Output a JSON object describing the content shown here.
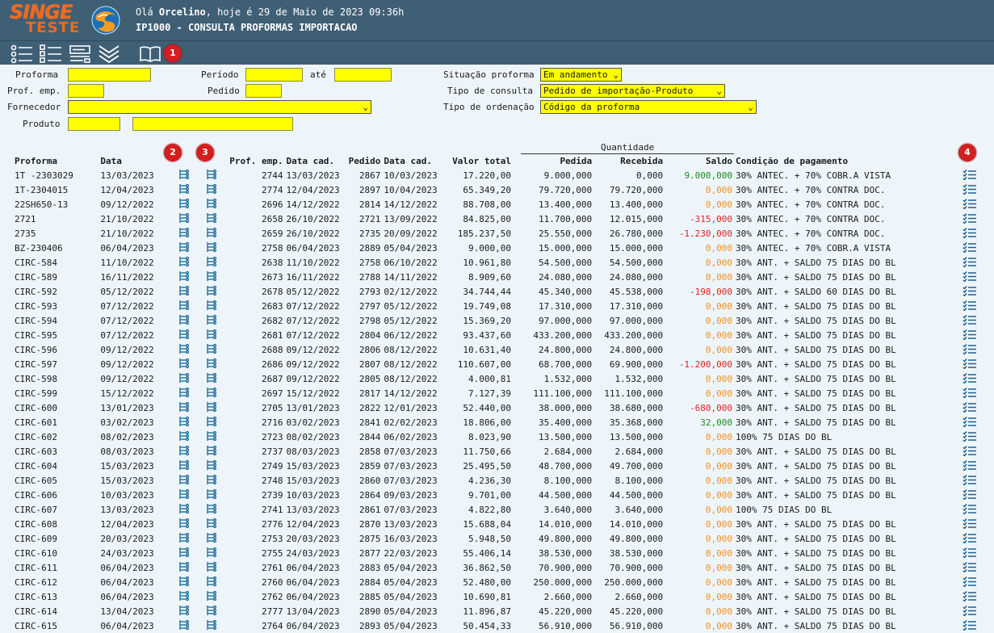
{
  "app": {
    "logo_top": "SINGE",
    "logo_bottom": "TESTE"
  },
  "header": {
    "greeting_pre": "Olá ",
    "user": "Orcelino",
    "greeting_post": ", hoje é 29 de Maio de 2023 09:36h",
    "program": "IP1000 - CONSULTA PROFORMAS IMPORTACAO"
  },
  "toolbar": {
    "badge": "1"
  },
  "form": {
    "proforma_label": "Proforma",
    "periodo_label": "Período",
    "ate_label": "até",
    "prof_emp_label": "Prof. emp.",
    "pedido_label": "Pedido",
    "fornecedor_label": "Fornecedor",
    "produto_label": "Produto",
    "situacao_label": "Situação proforma",
    "situacao_value": "Em andamento",
    "tipo_consulta_label": "Tipo de consulta",
    "tipo_consulta_value": "Pedido de importação-Produto",
    "tipo_ordenacao_label": "Tipo de ordenação",
    "tipo_ordenacao_value": "Código da proforma"
  },
  "badges": {
    "b2": "2",
    "b3": "3",
    "b4": "4"
  },
  "table": {
    "group_header": "Quantidade",
    "columns": [
      "Proforma",
      "Data",
      "Prof. emp.",
      "Data cad.",
      "Pedido",
      "Data cad.",
      "Valor total",
      "Pedida",
      "Recebida",
      "Saldo",
      "Condição de pagamento"
    ],
    "rows": [
      [
        "1T -2303029",
        "13/03/2023",
        "2744",
        "13/03/2023",
        "2867",
        "10/03/2023",
        "17.220,00",
        "9.000,000",
        "0,000",
        "9.000,000",
        "30% ANTEC. + 70% COBR.A VISTA",
        "pos"
      ],
      [
        "1T-2304015",
        "12/04/2023",
        "2774",
        "12/04/2023",
        "2897",
        "10/04/2023",
        "65.349,20",
        "79.720,000",
        "79.720,000",
        "0,000",
        "30% ANTEC. + 70% CONTRA DOC.",
        "zero"
      ],
      [
        "22SH650-13",
        "09/12/2022",
        "2696",
        "14/12/2022",
        "2814",
        "14/12/2022",
        "88.708,00",
        "13.400,000",
        "13.400,000",
        "0,000",
        "30% ANTEC. + 70% CONTRA DOC.",
        "zero"
      ],
      [
        "2721",
        "21/10/2022",
        "2658",
        "26/10/2022",
        "2721",
        "13/09/2022",
        "84.825,00",
        "11.700,000",
        "12.015,000",
        "-315,000",
        "30% ANTEC. + 70% CONTRA DOC.",
        "neg"
      ],
      [
        "2735",
        "21/10/2022",
        "2659",
        "26/10/2022",
        "2735",
        "20/09/2022",
        "185.237,50",
        "25.550,000",
        "26.780,000",
        "-1.230,000",
        "30% ANTEC. + 70% CONTRA DOC.",
        "neg"
      ],
      [
        "BZ-230406",
        "06/04/2023",
        "2758",
        "06/04/2023",
        "2889",
        "05/04/2023",
        "9.000,00",
        "15.000,000",
        "15.000,000",
        "0,000",
        "30% ANTEC. + 70% COBR.A VISTA",
        "zero"
      ],
      [
        "CIRC-584",
        "11/10/2022",
        "2638",
        "11/10/2022",
        "2758",
        "06/10/2022",
        "10.961,80",
        "54.500,000",
        "54.500,000",
        "0,000",
        "30% ANT. + SALDO 75 DIAS DO BL",
        "zero"
      ],
      [
        "CIRC-589",
        "16/11/2022",
        "2673",
        "16/11/2022",
        "2788",
        "14/11/2022",
        "8.909,60",
        "24.080,000",
        "24.080,000",
        "0,000",
        "30% ANT. + SALDO 75 DIAS DO BL",
        "zero"
      ],
      [
        "CIRC-592",
        "05/12/2022",
        "2678",
        "05/12/2022",
        "2793",
        "02/12/2022",
        "34.744,44",
        "45.340,000",
        "45.538,000",
        "-198,000",
        "30% ANT. + SALDO 60 DIAS DO BL",
        "neg"
      ],
      [
        "CIRC-593",
        "07/12/2022",
        "2683",
        "07/12/2022",
        "2797",
        "05/12/2022",
        "19.749,08",
        "17.310,000",
        "17.310,000",
        "0,000",
        "30% ANT. + SALDO 75 DIAS DO BL",
        "zero"
      ],
      [
        "CIRC-594",
        "07/12/2022",
        "2682",
        "07/12/2022",
        "2798",
        "05/12/2022",
        "15.369,20",
        "97.000,000",
        "97.000,000",
        "0,000",
        "30% ANT. + SALDO 75 DIAS DO BL",
        "zero"
      ],
      [
        "CIRC-595",
        "07/12/2022",
        "2681",
        "07/12/2022",
        "2804",
        "06/12/2022",
        "93.437,60",
        "433.200,000",
        "433.200,000",
        "0,000",
        "30% ANT. + SALDO 75 DIAS DO BL",
        "zero"
      ],
      [
        "CIRC-596",
        "09/12/2022",
        "2688",
        "09/12/2022",
        "2806",
        "08/12/2022",
        "10.631,40",
        "24.800,000",
        "24.800,000",
        "0,000",
        "30% ANT. + SALDO 75 DIAS DO BL",
        "zero"
      ],
      [
        "CIRC-597",
        "09/12/2022",
        "2686",
        "09/12/2022",
        "2807",
        "08/12/2022",
        "110.607,00",
        "68.700,000",
        "69.900,000",
        "-1.200,000",
        "30% ANT. + SALDO 75 DIAS DO BL",
        "neg"
      ],
      [
        "CIRC-598",
        "09/12/2022",
        "2687",
        "09/12/2022",
        "2805",
        "08/12/2022",
        "4.000,81",
        "1.532,000",
        "1.532,000",
        "0,000",
        "30% ANT. + SALDO 75 DIAS DO BL",
        "zero"
      ],
      [
        "CIRC-599",
        "15/12/2022",
        "2697",
        "15/12/2022",
        "2817",
        "14/12/2022",
        "7.127,39",
        "111.100,000",
        "111.100,000",
        "0,000",
        "30% ANT. + SALDO 75 DIAS DO BL",
        "zero"
      ],
      [
        "CIRC-600",
        "13/01/2023",
        "2705",
        "13/01/2023",
        "2822",
        "12/01/2023",
        "52.440,00",
        "38.000,000",
        "38.680,000",
        "-680,000",
        "30% ANT. + SALDO 75 DIAS DO BL",
        "neg"
      ],
      [
        "CIRC-601",
        "03/02/2023",
        "2716",
        "03/02/2023",
        "2841",
        "02/02/2023",
        "18.806,00",
        "35.400,000",
        "35.368,000",
        "32,000",
        "30% ANT. + SALDO 75 DIAS DO BL",
        "pos"
      ],
      [
        "CIRC-602",
        "08/02/2023",
        "2723",
        "08/02/2023",
        "2844",
        "06/02/2023",
        "8.023,90",
        "13.500,000",
        "13.500,000",
        "0,000",
        "100% 75 DIAS DO BL",
        "zero"
      ],
      [
        "CIRC-603",
        "08/03/2023",
        "2737",
        "08/03/2023",
        "2858",
        "07/03/2023",
        "11.750,66",
        "2.684,000",
        "2.684,000",
        "0,000",
        "30% ANT. + SALDO 75 DIAS DO BL",
        "zero"
      ],
      [
        "CIRC-604",
        "15/03/2023",
        "2749",
        "15/03/2023",
        "2859",
        "07/03/2023",
        "25.495,50",
        "48.700,000",
        "49.700,000",
        "0,000",
        "30% ANT. + SALDO 75 DIAS DO BL",
        "zero"
      ],
      [
        "CIRC-605",
        "15/03/2023",
        "2748",
        "15/03/2023",
        "2860",
        "07/03/2023",
        "4.236,30",
        "8.100,000",
        "8.100,000",
        "0,000",
        "30% ANT. + SALDO 75 DIAS DO BL",
        "zero"
      ],
      [
        "CIRC-606",
        "10/03/2023",
        "2739",
        "10/03/2023",
        "2864",
        "09/03/2023",
        "9.701,00",
        "44.500,000",
        "44.500,000",
        "0,000",
        "30% ANT. + SALDO 75 DIAS DO BL",
        "zero"
      ],
      [
        "CIRC-607",
        "13/03/2023",
        "2741",
        "13/03/2023",
        "2861",
        "07/03/2023",
        "4.822,80",
        "3.640,000",
        "3.640,000",
        "0,000",
        "100% 75 DIAS DO BL",
        "zero"
      ],
      [
        "CIRC-608",
        "12/04/2023",
        "2776",
        "12/04/2023",
        "2870",
        "13/03/2023",
        "15.688,04",
        "14.010,000",
        "14.010,000",
        "0,000",
        "30% ANT. + SALDO 75 DIAS DO BL",
        "zero"
      ],
      [
        "CIRC-609",
        "20/03/2023",
        "2753",
        "20/03/2023",
        "2875",
        "16/03/2023",
        "5.948,50",
        "49.800,000",
        "49.800,000",
        "0,000",
        "30% ANT. + SALDO 75 DIAS DO BL",
        "zero"
      ],
      [
        "CIRC-610",
        "24/03/2023",
        "2755",
        "24/03/2023",
        "2877",
        "22/03/2023",
        "55.406,14",
        "38.530,000",
        "38.530,000",
        "0,000",
        "30% ANT. + SALDO 75 DIAS DO BL",
        "zero"
      ],
      [
        "CIRC-611",
        "06/04/2023",
        "2761",
        "06/04/2023",
        "2883",
        "05/04/2023",
        "36.862,50",
        "70.900,000",
        "70.900,000",
        "0,000",
        "30% ANT. + SALDO 75 DIAS DO BL",
        "zero"
      ],
      [
        "CIRC-612",
        "06/04/2023",
        "2760",
        "06/04/2023",
        "2884",
        "05/04/2023",
        "52.480,00",
        "250.000,000",
        "250.000,000",
        "0,000",
        "30% ANT. + SALDO 75 DIAS DO BL",
        "zero"
      ],
      [
        "CIRC-613",
        "06/04/2023",
        "2762",
        "06/04/2023",
        "2885",
        "05/04/2023",
        "10.690,81",
        "2.660,000",
        "2.660,000",
        "0,000",
        "30% ANT. + SALDO 75 DIAS DO BL",
        "zero"
      ],
      [
        "CIRC-614",
        "13/04/2023",
        "2777",
        "13/04/2023",
        "2890",
        "05/04/2023",
        "11.896,87",
        "45.220,000",
        "45.220,000",
        "0,000",
        "30% ANT. + SALDO 75 DIAS DO BL",
        "zero"
      ],
      [
        "CIRC-615",
        "06/04/2023",
        "2764",
        "06/04/2023",
        "2893",
        "05/04/2023",
        "50.454,33",
        "56.910,000",
        "56.910,000",
        "0,000",
        "30% ANT. + SALDO 75 DIAS DO BL",
        "zero"
      ]
    ]
  }
}
